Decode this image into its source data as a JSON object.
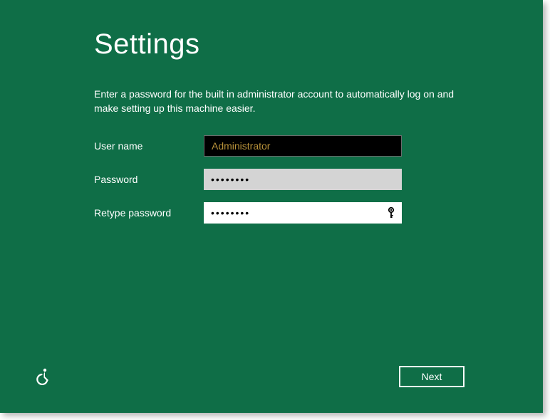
{
  "title": "Settings",
  "description": "Enter a password for the built in administrator account to automatically log on and make setting up this machine easier.",
  "form": {
    "username": {
      "label": "User name",
      "value": "Administrator"
    },
    "password": {
      "label": "Password",
      "value": "••••••••"
    },
    "retype": {
      "label": "Retype password",
      "value": "••••••••"
    }
  },
  "footer": {
    "next_label": "Next"
  },
  "colors": {
    "background": "#0f6e47",
    "username_text": "#b8923a"
  }
}
